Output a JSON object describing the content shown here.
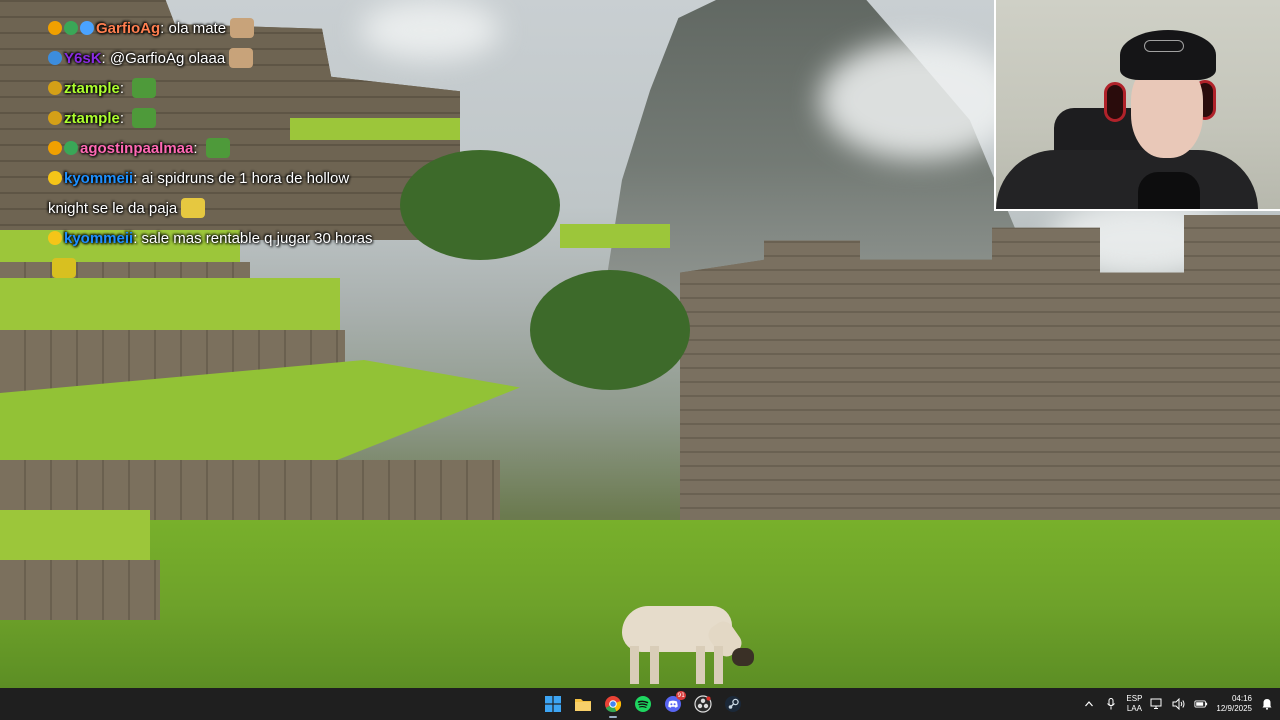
{
  "chat": {
    "messages": [
      {
        "user": "GarfioAg",
        "user_color": "#ff7f50",
        "text": "ola mate",
        "badges": [
          "#f0a000",
          "#3aa757",
          "#4aa3ff"
        ],
        "emotes": [
          "#c8a37a"
        ]
      },
      {
        "user": "Y6sK",
        "user_color": "#8a2be2",
        "text": "@GarfioAg olaaa",
        "badges": [
          "#3c8dde"
        ],
        "emotes": [
          "#c8a37a"
        ]
      },
      {
        "user": "ztample",
        "user_color": "#adff2f",
        "text": "",
        "badges": [
          "#d4a017"
        ],
        "emotes": [
          "#4e9a3a"
        ]
      },
      {
        "user": "ztample",
        "user_color": "#adff2f",
        "text": "",
        "badges": [
          "#d4a017"
        ],
        "emotes": [
          "#4e9a3a"
        ]
      },
      {
        "user": "agostinpaalmaa",
        "user_color": "#ff69b4",
        "text": "",
        "badges": [
          "#f0a000",
          "#3aa757"
        ],
        "emotes": [
          "#4e9a3a"
        ]
      },
      {
        "user": "kyommeii",
        "user_color": "#1e90ff",
        "text": "ai spidruns de 1 hora de hollow knight se le da paja",
        "badges": [
          "#f5c518"
        ],
        "emotes": [
          "#e6c840"
        ]
      },
      {
        "user": "kyommeii",
        "user_color": "#1e90ff",
        "text": "sale mas rentable q jugar 30 horas",
        "badges": [
          "#f5c518"
        ],
        "emotes": [
          "#d8c020"
        ]
      }
    ]
  },
  "taskbar": {
    "apps": [
      {
        "name": "windows-start-icon",
        "color": "#3da5f4"
      },
      {
        "name": "file-explorer-icon",
        "color": "#f5c242"
      },
      {
        "name": "chrome-icon",
        "color": "#e94235"
      },
      {
        "name": "spotify-icon",
        "color": "#1ed760"
      },
      {
        "name": "discord-icon",
        "color": "#5865f2"
      },
      {
        "name": "obs-icon",
        "color": "#dddddd"
      },
      {
        "name": "steam-icon",
        "color": "#c7d5e0"
      }
    ],
    "discord_badge": "91",
    "lang_top": "ESP",
    "lang_bottom": "LAA",
    "time": "04:16",
    "date": "12/9/2025"
  }
}
